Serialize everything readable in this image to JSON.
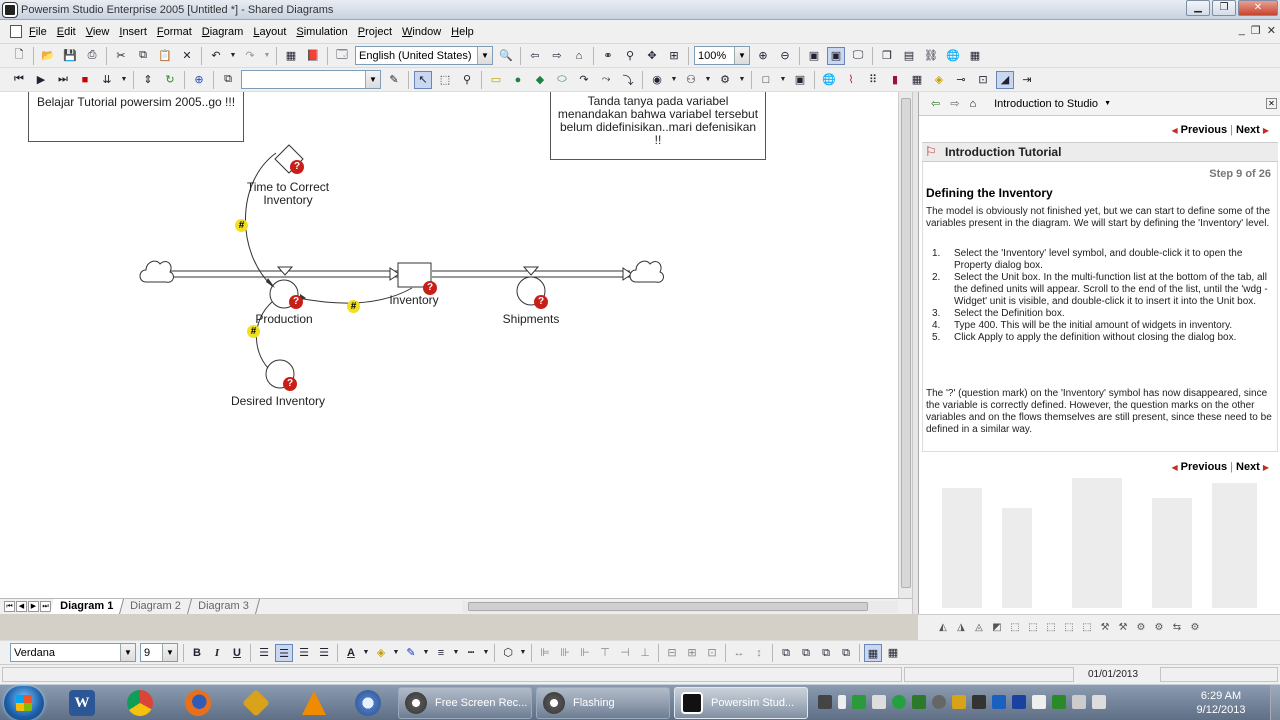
{
  "window": {
    "title": "Powersim Studio Enterprise 2005 [Untitled *] - Shared Diagrams"
  },
  "menu": [
    "File",
    "Edit",
    "View",
    "Insert",
    "Format",
    "Diagram",
    "Layout",
    "Simulation",
    "Project",
    "Window",
    "Help"
  ],
  "toolbar1": {
    "language": "English (United States)",
    "zoom": "100%"
  },
  "toolbar2": {
    "combo_value": ""
  },
  "diagram": {
    "notes": [
      {
        "text": "Belajar Tutorial powersim 2005..go !!!"
      },
      {
        "text": "Tanda tanya pada variabel menandakan bahwa variabel tersebut belum didefinisikan..mari defenisikan !!"
      }
    ],
    "variables": {
      "time_to_correct": "Time to Correct Inventory",
      "production": "Production",
      "inventory": "Inventory",
      "shipments": "Shipments",
      "desired": "Desired Inventory"
    },
    "markers": {
      "question": "?",
      "hash": "#"
    }
  },
  "tabs": [
    "Diagram 1",
    "Diagram 2",
    "Diagram 3"
  ],
  "panel": {
    "breadcrumb": "Introduction to Studio",
    "previous": "Previous",
    "next": "Next",
    "header": "Introduction Tutorial",
    "step": "Step 9 of 26",
    "heading": "Defining the Inventory",
    "intro": "The model is obviously not finished yet, but we can start to define some of the variables present in the diagram. We will start by defining the 'Inventory' level.",
    "steps": [
      {
        "num": "1.",
        "text": "Select the 'Inventory' level symbol, and double-click it to open the Property dialog box."
      },
      {
        "num": "2.",
        "text": "Select the Unit box. In the multi-function list at the bottom of the tab, all the defined units will appear. Scroll to the end of the list, until the 'wdg - Widget' unit is visible, and double-click it to insert it into the Unit box."
      },
      {
        "num": "3.",
        "text": "Select the Definition box."
      },
      {
        "num": "4.",
        "text": "Type 400. This will be the initial amount of widgets in inventory."
      },
      {
        "num": "5.",
        "text": "Click Apply to apply the definition without closing the dialog box."
      }
    ],
    "outro": "The '?' (question mark) on the 'Inventory' symbol has now disappeared, since the variable is correctly defined. However, the question marks on the other variables and on the flows themselves are still present, since these need to be defined in a similar way."
  },
  "format": {
    "font": "Verdana",
    "size": "9",
    "bold": "B",
    "italic": "I",
    "underline": "U"
  },
  "status": {
    "date": "01/01/2013"
  },
  "taskbar": {
    "tasks": [
      {
        "label": "Free Screen Rec..."
      },
      {
        "label": "Flashing"
      },
      {
        "label": "Powersim Stud..."
      }
    ],
    "time": "6:29 AM",
    "date": "9/12/2013"
  }
}
